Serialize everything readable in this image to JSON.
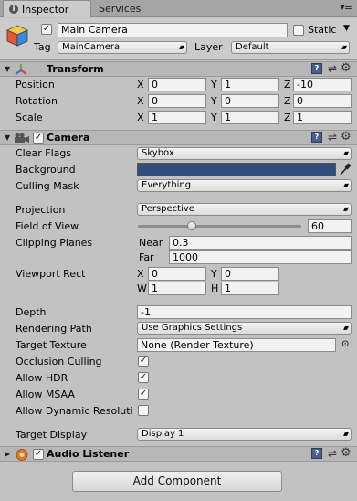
{
  "tabs": {
    "inspector": "Inspector",
    "services": "Services"
  },
  "object": {
    "name": "Main Camera",
    "active": true,
    "static_label": "Static",
    "static": false,
    "tag_label": "Tag",
    "tag_value": "MainCamera",
    "layer_label": "Layer",
    "layer_value": "Default"
  },
  "transform": {
    "title": "Transform",
    "position_label": "Position",
    "rotation_label": "Rotation",
    "scale_label": "Scale",
    "axis_x": "X",
    "axis_y": "Y",
    "axis_z": "Z",
    "position": {
      "x": "0",
      "y": "1",
      "z": "-10"
    },
    "rotation": {
      "x": "0",
      "y": "0",
      "z": "0"
    },
    "scale": {
      "x": "1",
      "y": "1",
      "z": "1"
    }
  },
  "camera": {
    "title": "Camera",
    "enabled": true,
    "clear_flags_label": "Clear Flags",
    "clear_flags_value": "Skybox",
    "background_label": "Background",
    "background_color": "#314d79",
    "culling_mask_label": "Culling Mask",
    "culling_mask_value": "Everything",
    "projection_label": "Projection",
    "projection_value": "Perspective",
    "fov_label": "Field of View",
    "fov_value": "60",
    "fov_fraction": 0.33,
    "clipping_label": "Clipping Planes",
    "near_label": "Near",
    "near_value": "0.3",
    "far_label": "Far",
    "far_value": "1000",
    "viewport_label": "Viewport Rect",
    "vp_x_label": "X",
    "vp_y_label": "Y",
    "vp_w_label": "W",
    "vp_h_label": "H",
    "vp_x": "0",
    "vp_y": "0",
    "vp_w": "1",
    "vp_h": "1",
    "depth_label": "Depth",
    "depth_value": "-1",
    "rendering_path_label": "Rendering Path",
    "rendering_path_value": "Use Graphics Settings",
    "target_texture_label": "Target Texture",
    "target_texture_value": "None (Render Texture)",
    "occlusion_label": "Occlusion Culling",
    "occlusion": true,
    "hdr_label": "Allow HDR",
    "hdr": true,
    "msaa_label": "Allow MSAA",
    "msaa": true,
    "dynamic_label": "Allow Dynamic Resoluti",
    "dynamic": false,
    "target_display_label": "Target Display",
    "target_display_value": "Display 1"
  },
  "audio_listener": {
    "title": "Audio Listener",
    "enabled": true
  },
  "add_component_label": "Add Component",
  "check_glyph": "✓",
  "colors": {
    "accent": "#314d79"
  }
}
